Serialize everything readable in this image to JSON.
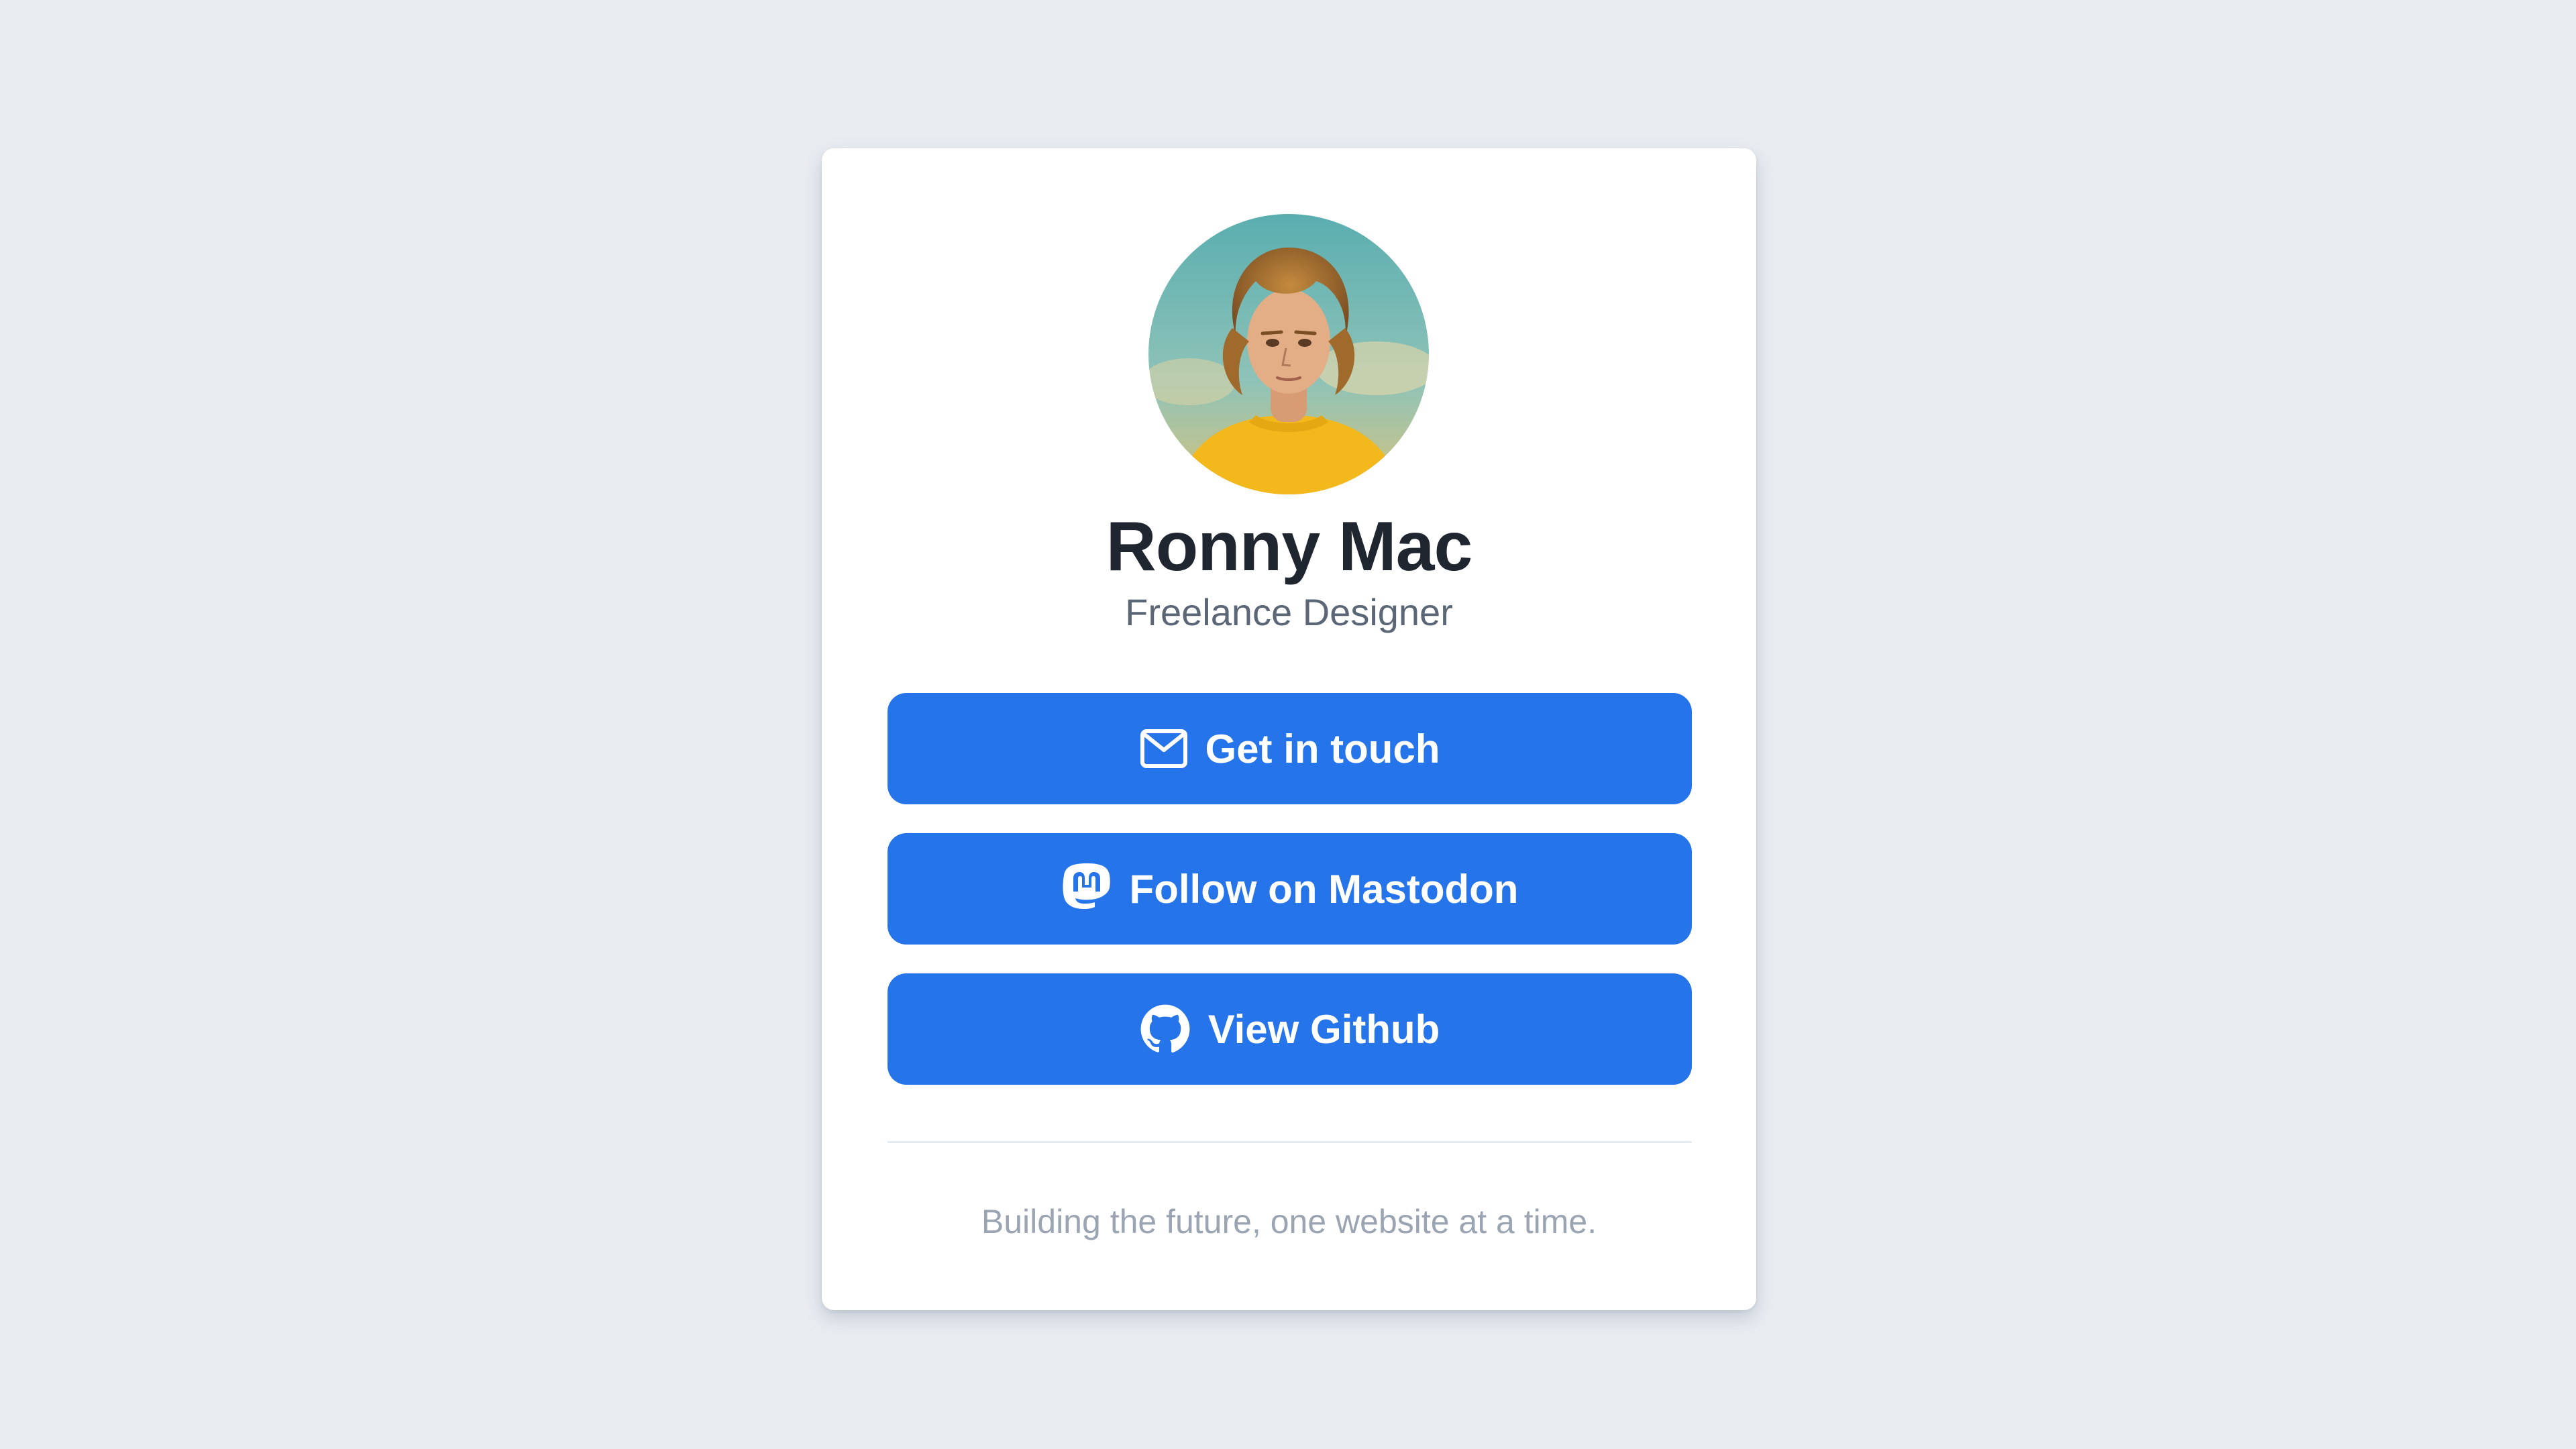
{
  "profile": {
    "name": "Ronny Mac",
    "title": "Freelance Designer",
    "avatar_icon": "avatar-portrait"
  },
  "buttons": [
    {
      "label": "Get in touch",
      "icon": "envelope-icon"
    },
    {
      "label": "Follow on Mastodon",
      "icon": "mastodon-icon"
    },
    {
      "label": "View Github",
      "icon": "github-icon"
    }
  ],
  "footer": {
    "tagline": "Building the future, one website at a time."
  },
  "colors": {
    "background": "#e9edf2",
    "card": "#ffffff",
    "button": "#2574ea",
    "name_text": "#1f2630",
    "title_text": "#5b6777",
    "tagline_text": "#9aa4b2"
  }
}
